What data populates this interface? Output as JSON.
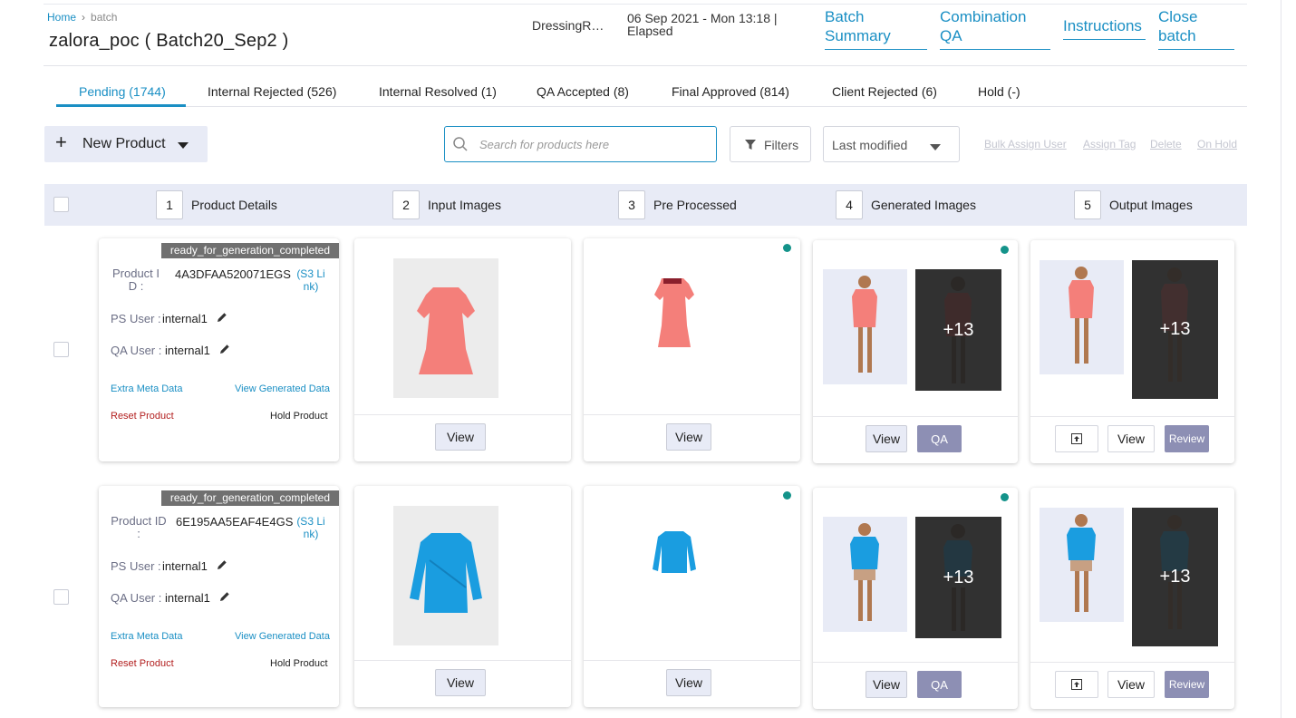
{
  "breadcrumb": {
    "home": "Home",
    "separator": "›",
    "current": "batch"
  },
  "page_title": "zalora_poc ( Batch20_Sep2 )",
  "header": {
    "client_name": "DressingRo...",
    "datetime_line1": "06 Sep 2021 - Mon 13:18 |",
    "datetime_line2": "Elapsed",
    "links": {
      "batch_summary_1": "Batch",
      "batch_summary_2": "Summary",
      "combination_qa_1": "Combination",
      "combination_qa_2": "QA",
      "instructions": "Instructions",
      "close_batch_1": "Close",
      "close_batch_2": "batch"
    }
  },
  "tabs": [
    {
      "label": "Pending (1744)"
    },
    {
      "label": "Internal Rejected (526)"
    },
    {
      "label": "Internal Resolved (1)"
    },
    {
      "label": "QA Accepted (8)"
    },
    {
      "label": "Final Approved (814)"
    },
    {
      "label": "Client Rejected (6)"
    },
    {
      "label": "Hold (-)"
    }
  ],
  "toolbar": {
    "new_product": "New Product",
    "search_placeholder": "Search for products here",
    "filters": "Filters",
    "sort_value": "Last modified",
    "bulk_actions": [
      "Bulk Assign User",
      "Assign Tag",
      "Delete",
      "On Hold"
    ]
  },
  "columns": [
    {
      "num": "1",
      "label": "Product Details"
    },
    {
      "num": "2",
      "label": "Input Images"
    },
    {
      "num": "3",
      "label": "Pre Processed"
    },
    {
      "num": "4",
      "label": "Generated Images"
    },
    {
      "num": "5",
      "label": "Output Images"
    }
  ],
  "products": [
    {
      "status": "ready_for_generation_completed",
      "product_id_label_1": "Product I",
      "product_id_label_2": "D :",
      "product_id": "4A3DFAA520071EGS",
      "s3_1": "(S3 Li",
      "s3_2": "nk)",
      "ps_user_label": "PS User :",
      "ps_user": "internal1",
      "qa_user_label": "QA User :",
      "qa_user": "internal1",
      "extra_meta": "Extra Meta Data",
      "view_generated": "View Generated Data",
      "reset": "Reset Product",
      "hold": "Hold Product",
      "garment_color": "#f47f7a",
      "garment_type": "dress",
      "generated_more": "+13",
      "output_more": "+13",
      "view": "View",
      "qa": "QA",
      "review": "Review"
    },
    {
      "status": "ready_for_generation_completed",
      "product_id_label_1": "Product ID",
      "product_id_label_2": ":",
      "product_id": "6E195AA5EAF4E4GS",
      "s3_1": "(S3 Li",
      "s3_2": "nk)",
      "ps_user_label": "PS User :",
      "ps_user": "internal1",
      "qa_user_label": "QA User :",
      "qa_user": "internal1",
      "extra_meta": "Extra Meta Data",
      "view_generated": "View Generated Data",
      "reset": "Reset Product",
      "hold": "Hold Product",
      "garment_color": "#1a9de0",
      "garment_type": "top",
      "generated_more": "+13",
      "output_more": "+13",
      "view": "View",
      "qa": "QA",
      "review": "Review"
    }
  ],
  "colors": {
    "accent": "#1a8fc4",
    "status_dot": "#14938a",
    "badge": "#707070",
    "header_band": "#e8ebf6"
  }
}
